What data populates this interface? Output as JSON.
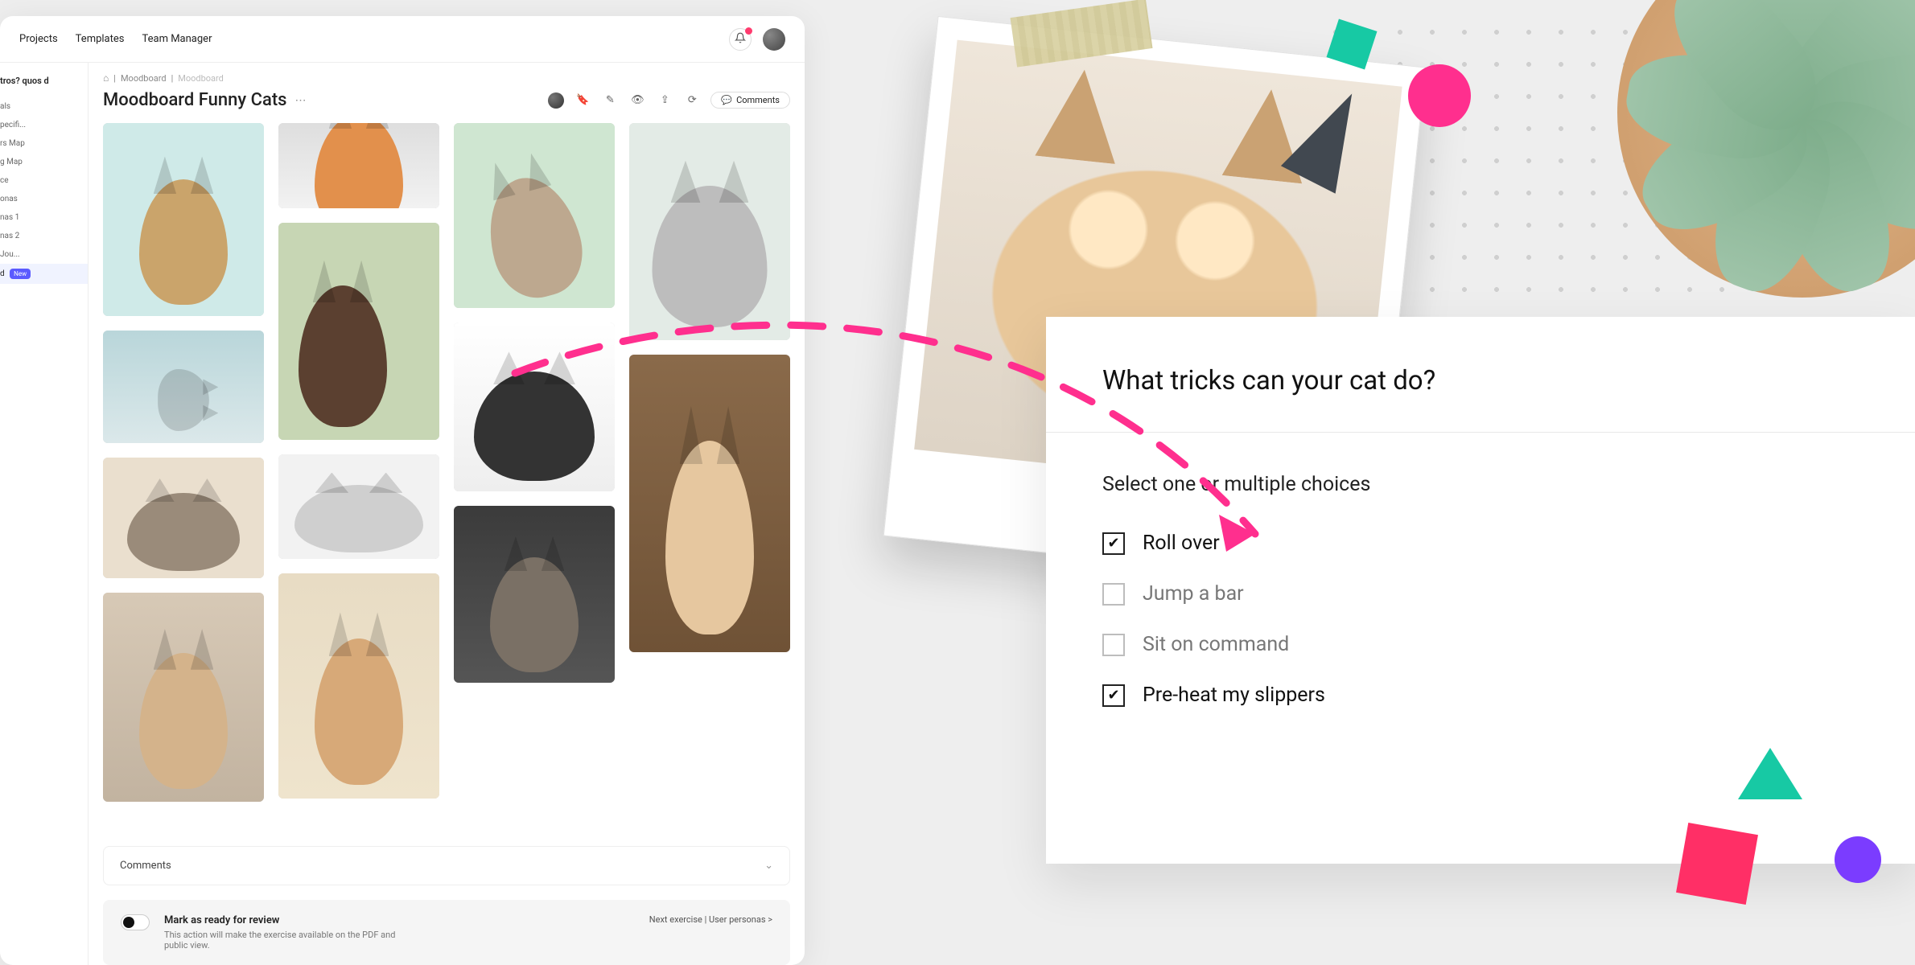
{
  "nav": {
    "projects": "Projects",
    "templates": "Templates",
    "team_manager": "Team Manager"
  },
  "sidebar": {
    "project_name": "tros? quos d",
    "items": [
      {
        "label": "als"
      },
      {
        "label": "pecifi..."
      },
      {
        "label": "rs Map"
      },
      {
        "label": "g Map"
      },
      {
        "label": "ce"
      },
      {
        "label": "onas"
      },
      {
        "label": "nas 1"
      },
      {
        "label": "nas 2"
      },
      {
        "label": "Jou..."
      },
      {
        "label": "d",
        "new": true
      }
    ],
    "new_badge": "New"
  },
  "breadcrumb": {
    "root": "Moodboard",
    "current": "Moodboard"
  },
  "page": {
    "title": "Moodboard Funny Cats",
    "comments_btn": "Comments"
  },
  "comments_panel": {
    "title": "Comments"
  },
  "review": {
    "title": "Mark as ready for review",
    "desc": "This action will make the exercise available on the PDF and public view.",
    "next": "Next exercise | User personas  >"
  },
  "survey": {
    "question": "What tricks can your cat do?",
    "subtitle": "Select one or multiple choices",
    "options": [
      {
        "label": "Roll over",
        "checked": true
      },
      {
        "label": "Jump a bar",
        "checked": false
      },
      {
        "label": "Sit on command",
        "checked": false
      },
      {
        "label": "Pre-heat my slippers",
        "checked": true
      }
    ]
  }
}
